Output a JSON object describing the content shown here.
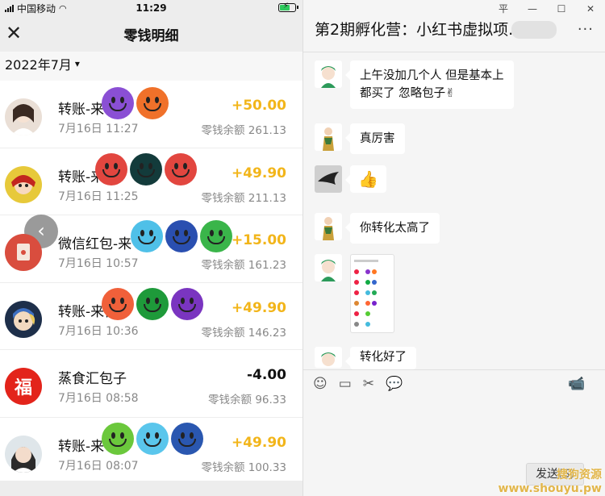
{
  "phone": {
    "status": {
      "carrier": "中国移动",
      "time": "11:29"
    },
    "nav": {
      "title": "零钱明细"
    },
    "month": "2022年7月",
    "transactions": [
      {
        "name": "转账-来",
        "date": "7月16日 11:27",
        "amount": "+50.00",
        "balance": "零钱余额 261.13"
      },
      {
        "name": "转账-来",
        "date": "7月16日 11:25",
        "amount": "+49.90",
        "balance": "零钱余额 211.13"
      },
      {
        "name": "微信红包-来",
        "date": "7月16日 10:57",
        "amount": "+15.00",
        "balance": "零钱余额 161.23"
      },
      {
        "name": "转账-来自",
        "date": "7月16日 10:36",
        "amount": "+49.90",
        "balance": "零钱余额 146.23"
      },
      {
        "name": "蒸食汇包子",
        "date": "7月16日 08:58",
        "amount": "-4.00",
        "balance": "零钱余额 96.33"
      },
      {
        "name": "转账-来",
        "date": "7月16日 08:07",
        "amount": "+49.90",
        "balance": "零钱余额 100.33"
      }
    ],
    "logo_text": "福"
  },
  "chat": {
    "title": "第2期孵化营：小红书虚拟项...",
    "window_controls": {
      "pin": "平",
      "minimize": "—",
      "maximize": "☐",
      "close": "✕"
    },
    "more": "···",
    "messages": [
      {
        "text": "上午没加几个人 但是基本上都买了 忽略包子✌"
      },
      {
        "text": "真厉害"
      },
      {
        "text": "👍"
      },
      {
        "text": "你转化太高了"
      },
      {
        "text": ""
      },
      {
        "text": "转化好了"
      }
    ],
    "toolbar": {
      "emoji": "☺",
      "folder": "▭",
      "scissors": "✂",
      "chat": "💬",
      "video": "📹"
    },
    "send_label": "发送(S)",
    "watermark": [
      "搜狗资源",
      "www.shouyu.pw"
    ]
  },
  "colors": {
    "income": "#f2b51a",
    "expense": "#111111",
    "red": "#d94d3e"
  }
}
